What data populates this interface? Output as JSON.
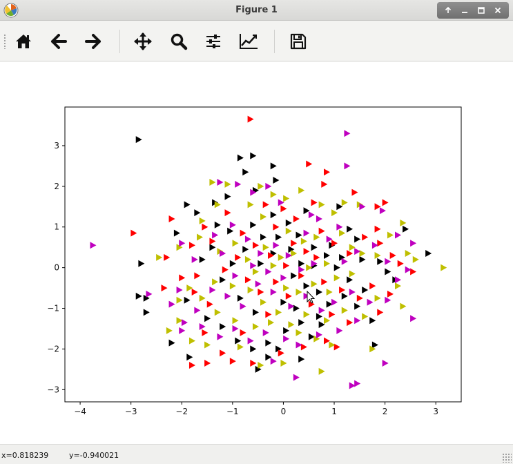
{
  "window": {
    "title": "Figure 1",
    "controls": [
      "up-icon",
      "minimize-icon",
      "maximize-icon",
      "close-icon"
    ]
  },
  "toolbar": {
    "buttons": [
      {
        "name": "home-button",
        "icon": "home-icon"
      },
      {
        "name": "back-button",
        "icon": "arrow-left-icon"
      },
      {
        "name": "forward-button",
        "icon": "arrow-right-icon"
      },
      {
        "name": "pan-button",
        "icon": "move-icon"
      },
      {
        "name": "zoom-button",
        "icon": "magnifier-icon"
      },
      {
        "name": "subplots-button",
        "icon": "sliders-icon"
      },
      {
        "name": "edit-axes-button",
        "icon": "line-chart-icon"
      },
      {
        "name": "save-button",
        "icon": "floppy-disk-icon"
      }
    ]
  },
  "status": {
    "x_readout": "x=0.818239",
    "y_readout": "y=-0.940021"
  },
  "colors": {
    "black": "#000000",
    "red": "#ff0000",
    "olive": "#bfbf00",
    "magenta": "#bf00bf"
  },
  "chart_data": {
    "type": "scatter",
    "marker": "triangle-right",
    "title": "",
    "xlabel": "",
    "ylabel": "",
    "xlim": [
      -4.3,
      3.5
    ],
    "ylim": [
      -3.3,
      3.95
    ],
    "xticks": [
      "−4",
      "−3",
      "−2",
      "−1",
      "0",
      "1",
      "2",
      "3"
    ],
    "xtick_values": [
      -4,
      -3,
      -2,
      -1,
      0,
      1,
      2,
      3
    ],
    "yticks": [
      "−3",
      "−2",
      "−1",
      "0",
      "1",
      "2",
      "3"
    ],
    "ytick_values": [
      -3,
      -2,
      -1,
      0,
      1,
      2,
      3
    ],
    "grid": false,
    "legend": "none",
    "series": [
      {
        "color": "#000000",
        "points": [
          [
            -2.85,
            3.15
          ],
          [
            -0.85,
            2.7
          ],
          [
            -0.6,
            2.75
          ],
          [
            -0.2,
            2.5
          ],
          [
            -0.75,
            2.35
          ],
          [
            -0.15,
            2.15
          ],
          [
            -0.55,
            1.9
          ],
          [
            -1.1,
            1.75
          ],
          [
            -1.35,
            1.6
          ],
          [
            -1.9,
            1.55
          ],
          [
            -1.7,
            1.35
          ],
          [
            -2.1,
            0.85
          ],
          [
            -1.4,
            0.5
          ],
          [
            -1.05,
            0.9
          ],
          [
            -0.6,
            1.05
          ],
          [
            -0.4,
            0.75
          ],
          [
            -0.2,
            1.3
          ],
          [
            0.1,
            1.1
          ],
          [
            0.3,
            0.8
          ],
          [
            0.45,
            1.4
          ],
          [
            0.6,
            0.5
          ],
          [
            0.85,
            0.3
          ],
          [
            1.1,
            1.5
          ],
          [
            1.3,
            0.95
          ],
          [
            1.45,
            0.7
          ],
          [
            1.55,
            0.2
          ],
          [
            1.9,
            0.15
          ],
          [
            2.05,
            -0.1
          ],
          [
            2.2,
            -0.3
          ],
          [
            2.4,
            0.95
          ],
          [
            2.85,
            0.35
          ],
          [
            -2.8,
            0.1
          ],
          [
            -2.85,
            -0.7
          ],
          [
            -2.7,
            -0.75
          ],
          [
            -2.7,
            -1.1
          ],
          [
            -1.9,
            -0.8
          ],
          [
            -1.5,
            -1.25
          ],
          [
            -1.2,
            -1.45
          ],
          [
            -0.9,
            -1.8
          ],
          [
            -0.6,
            -2.0
          ],
          [
            -0.3,
            -1.85
          ],
          [
            -0.1,
            -2.0
          ],
          [
            0.05,
            -1.55
          ],
          [
            0.35,
            -1.35
          ],
          [
            0.55,
            -1.7
          ],
          [
            0.7,
            -1.2
          ],
          [
            0.9,
            -0.9
          ],
          [
            1.2,
            -0.7
          ],
          [
            1.45,
            -0.95
          ],
          [
            1.8,
            -1.9
          ],
          [
            1.75,
            -1.3
          ],
          [
            -2.2,
            -1.85
          ],
          [
            -1.85,
            -2.2
          ],
          [
            -0.3,
            -2.2
          ],
          [
            0.35,
            -2.25
          ],
          [
            -0.5,
            -2.5
          ],
          [
            0.2,
            -0.2
          ],
          [
            0.45,
            -0.45
          ],
          [
            0.7,
            -0.6
          ],
          [
            1.05,
            0.0
          ],
          [
            -0.2,
            0.35
          ],
          [
            -0.45,
            0.1
          ],
          [
            -0.75,
            0.45
          ],
          [
            -1.0,
            0.1
          ],
          [
            -1.2,
            -0.3
          ],
          [
            -0.85,
            -0.75
          ],
          [
            -0.55,
            -1.1
          ],
          [
            0.0,
            -0.85
          ],
          [
            0.25,
            -1.0
          ],
          [
            0.6,
            0.05
          ],
          [
            0.95,
            0.55
          ],
          [
            0.15,
            0.45
          ],
          [
            -0.1,
            0.75
          ],
          [
            1.3,
            -0.3
          ],
          [
            1.6,
            -0.55
          ],
          [
            0.75,
            -1.4
          ],
          [
            -1.6,
            0.2
          ],
          [
            -1.3,
            1.05
          ],
          [
            1.15,
            0.25
          ],
          [
            0.35,
            0.1
          ]
        ]
      },
      {
        "color": "#ff0000",
        "points": [
          [
            -0.65,
            3.65
          ],
          [
            0.5,
            2.55
          ],
          [
            0.85,
            2.35
          ],
          [
            0.8,
            2.05
          ],
          [
            1.4,
            1.85
          ],
          [
            2.0,
            1.6
          ],
          [
            1.85,
            1.5
          ],
          [
            -2.2,
            1.2
          ],
          [
            -1.8,
            0.55
          ],
          [
            -2.95,
            0.85
          ],
          [
            -2.3,
            0.25
          ],
          [
            -2.35,
            -0.5
          ],
          [
            -1.55,
            1.0
          ],
          [
            -1.1,
            1.35
          ],
          [
            -0.8,
            0.85
          ],
          [
            -0.35,
            1.55
          ],
          [
            0.0,
            1.45
          ],
          [
            0.25,
            1.2
          ],
          [
            0.6,
            1.6
          ],
          [
            0.75,
            0.9
          ],
          [
            1.0,
            0.6
          ],
          [
            1.3,
            0.35
          ],
          [
            1.6,
            0.75
          ],
          [
            1.85,
            0.95
          ],
          [
            1.9,
            0.6
          ],
          [
            2.15,
            0.3
          ],
          [
            2.55,
            -0.1
          ],
          [
            2.3,
            0.1
          ],
          [
            -2.0,
            -0.25
          ],
          [
            -1.75,
            -0.6
          ],
          [
            -1.45,
            -0.9
          ],
          [
            -1.55,
            -1.6
          ],
          [
            -1.2,
            -2.1
          ],
          [
            -1.0,
            -2.3
          ],
          [
            -0.6,
            -2.35
          ],
          [
            -0.05,
            -2.1
          ],
          [
            0.4,
            -1.95
          ],
          [
            0.85,
            -1.8
          ],
          [
            1.05,
            -1.95
          ],
          [
            1.5,
            -0.75
          ],
          [
            1.75,
            -0.45
          ],
          [
            2.1,
            -0.65
          ],
          [
            1.9,
            -1.1
          ],
          [
            -1.5,
            -2.35
          ],
          [
            -1.8,
            -2.4
          ],
          [
            -0.8,
            -1.6
          ],
          [
            -0.3,
            -1.15
          ],
          [
            0.1,
            -0.7
          ],
          [
            0.35,
            -0.2
          ],
          [
            0.55,
            -0.9
          ],
          [
            0.8,
            -0.35
          ],
          [
            1.15,
            -0.55
          ],
          [
            0.65,
            0.25
          ],
          [
            0.2,
            0.6
          ],
          [
            -0.25,
            0.3
          ],
          [
            -0.55,
            0.55
          ],
          [
            -0.9,
            0.25
          ],
          [
            -1.15,
            -0.05
          ],
          [
            -0.7,
            -0.3
          ],
          [
            -0.45,
            -0.6
          ],
          [
            -0.15,
            -0.35
          ],
          [
            0.05,
            0.05
          ],
          [
            0.45,
            0.4
          ],
          [
            -1.4,
            0.65
          ],
          [
            -1.7,
            -0.2
          ],
          [
            0.95,
            -1.15
          ],
          [
            1.3,
            -1.35
          ],
          [
            -0.15,
            1.0
          ]
        ]
      },
      {
        "color": "#bfbf00",
        "points": [
          [
            -1.4,
            2.1
          ],
          [
            -1.1,
            2.05
          ],
          [
            -1.3,
            1.55
          ],
          [
            -0.65,
            1.55
          ],
          [
            -0.45,
            2.0
          ],
          [
            -0.2,
            1.8
          ],
          [
            0.05,
            1.7
          ],
          [
            0.35,
            1.9
          ],
          [
            0.75,
            1.55
          ],
          [
            1.0,
            1.35
          ],
          [
            1.2,
            1.6
          ],
          [
            1.5,
            1.55
          ],
          [
            2.35,
            1.1
          ],
          [
            2.1,
            0.8
          ],
          [
            2.45,
            0.35
          ],
          [
            2.6,
            0.2
          ],
          [
            3.15,
            0.0
          ],
          [
            -2.45,
            0.25
          ],
          [
            -2.05,
            0.5
          ],
          [
            -1.65,
            0.75
          ],
          [
            -1.25,
            0.4
          ],
          [
            -0.95,
            0.6
          ],
          [
            -0.7,
            0.2
          ],
          [
            -0.35,
            0.5
          ],
          [
            -0.05,
            0.25
          ],
          [
            0.2,
            0.35
          ],
          [
            0.4,
            0.65
          ],
          [
            0.65,
            0.75
          ],
          [
            0.85,
            0.1
          ],
          [
            1.15,
            0.85
          ],
          [
            1.35,
            0.5
          ],
          [
            1.55,
            0.35
          ],
          [
            1.85,
            0.3
          ],
          [
            2.25,
            -0.45
          ],
          [
            2.35,
            -0.95
          ],
          [
            1.85,
            -0.75
          ],
          [
            1.6,
            -1.2
          ],
          [
            1.2,
            -1.05
          ],
          [
            0.85,
            -1.3
          ],
          [
            0.45,
            -1.15
          ],
          [
            0.15,
            -1.4
          ],
          [
            -0.25,
            -1.35
          ],
          [
            -0.55,
            -1.45
          ],
          [
            -0.95,
            -1.3
          ],
          [
            -1.3,
            -1.1
          ],
          [
            -1.6,
            -0.75
          ],
          [
            -1.85,
            -0.5
          ],
          [
            -2.05,
            -0.8
          ],
          [
            -2.05,
            -1.3
          ],
          [
            -2.25,
            -1.55
          ],
          [
            -1.8,
            -1.8
          ],
          [
            -1.5,
            -1.9
          ],
          [
            -0.85,
            -1.95
          ],
          [
            -0.45,
            -2.4
          ],
          [
            0.0,
            -2.35
          ],
          [
            0.75,
            -2.55
          ],
          [
            1.75,
            -2.0
          ],
          [
            0.95,
            -1.9
          ],
          [
            0.65,
            -1.75
          ],
          [
            0.3,
            -1.6
          ],
          [
            -0.1,
            -1.1
          ],
          [
            -0.4,
            -0.85
          ],
          [
            -0.65,
            -0.55
          ],
          [
            -1.0,
            -0.45
          ],
          [
            -1.35,
            -0.35
          ],
          [
            0.05,
            -0.5
          ],
          [
            0.3,
            -0.6
          ],
          [
            0.6,
            -0.4
          ],
          [
            0.9,
            -0.6
          ],
          [
            1.05,
            -0.25
          ],
          [
            1.35,
            -0.15
          ],
          [
            -0.2,
            0.05
          ],
          [
            -0.55,
            -0.1
          ],
          [
            0.5,
            0.0
          ],
          [
            0.1,
            0.9
          ],
          [
            -1.6,
            1.15
          ],
          [
            -0.4,
            1.25
          ]
        ]
      },
      {
        "color": "#bf00bf",
        "points": [
          [
            -3.75,
            0.55
          ],
          [
            1.25,
            3.3
          ],
          [
            1.25,
            2.5
          ],
          [
            -1.25,
            2.1
          ],
          [
            -0.9,
            2.05
          ],
          [
            -0.6,
            1.85
          ],
          [
            -0.3,
            2.0
          ],
          [
            1.55,
            1.5
          ],
          [
            1.95,
            1.4
          ],
          [
            2.25,
            0.8
          ],
          [
            2.55,
            0.6
          ],
          [
            -2.0,
            0.6
          ],
          [
            -1.75,
            0.2
          ],
          [
            -1.35,
            0.8
          ],
          [
            -1.0,
            1.05
          ],
          [
            -0.7,
            0.7
          ],
          [
            -0.45,
            0.35
          ],
          [
            -0.15,
            0.55
          ],
          [
            0.1,
            0.3
          ],
          [
            0.45,
            0.85
          ],
          [
            0.7,
            1.2
          ],
          [
            0.9,
            0.7
          ],
          [
            1.2,
            0.15
          ],
          [
            1.45,
            0.4
          ],
          [
            1.8,
            0.55
          ],
          [
            2.05,
            0.15
          ],
          [
            2.45,
            -0.05
          ],
          [
            2.25,
            -0.3
          ],
          [
            2.55,
            -1.25
          ],
          [
            2.05,
            -0.8
          ],
          [
            1.7,
            -0.85
          ],
          [
            1.35,
            -0.6
          ],
          [
            1.0,
            -0.85
          ],
          [
            0.75,
            -1.05
          ],
          [
            0.45,
            -0.7
          ],
          [
            0.15,
            -0.95
          ],
          [
            -0.2,
            -0.6
          ],
          [
            -0.5,
            -0.4
          ],
          [
            -0.8,
            -0.95
          ],
          [
            -1.1,
            -0.7
          ],
          [
            -1.4,
            -0.55
          ],
          [
            -1.7,
            -1.05
          ],
          [
            -2.05,
            -0.55
          ],
          [
            -2.2,
            -0.9
          ],
          [
            -1.95,
            -1.35
          ],
          [
            -1.6,
            -1.45
          ],
          [
            -1.25,
            -1.7
          ],
          [
            -0.95,
            -1.5
          ],
          [
            -0.65,
            -1.8
          ],
          [
            -0.35,
            -1.6
          ],
          [
            0.05,
            -1.75
          ],
          [
            0.3,
            -1.9
          ],
          [
            0.7,
            -1.65
          ],
          [
            1.1,
            -1.55
          ],
          [
            1.45,
            -1.3
          ],
          [
            2.0,
            -2.35
          ],
          [
            1.35,
            -2.9
          ],
          [
            1.45,
            -2.85
          ],
          [
            0.25,
            -2.7
          ],
          [
            -0.2,
            -2.3
          ],
          [
            -2.65,
            -0.65
          ],
          [
            -2.0,
            -1.55
          ],
          [
            0.6,
            0.1
          ],
          [
            0.35,
            -0.05
          ],
          [
            0.0,
            -0.25
          ],
          [
            -0.3,
            -0.1
          ],
          [
            -0.6,
            0.05
          ],
          [
            -0.95,
            -0.2
          ],
          [
            -1.2,
            0.35
          ],
          [
            1.1,
            1.0
          ],
          [
            0.55,
            1.3
          ],
          [
            -0.05,
            1.6
          ]
        ]
      }
    ]
  }
}
